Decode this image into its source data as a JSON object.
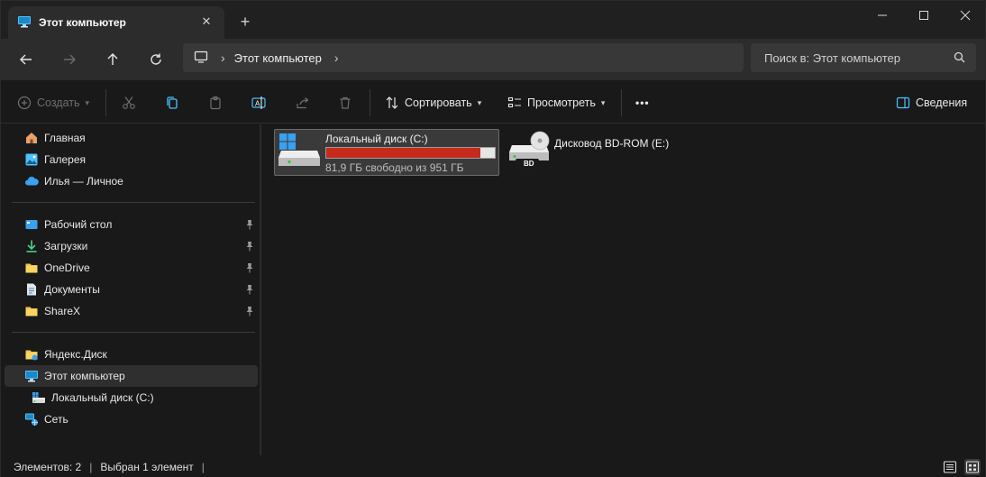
{
  "window": {
    "tab_title": "Этот компьютер",
    "new_tab_symbol": "+",
    "close_tab_symbol": "✕"
  },
  "nav": {
    "address_segment": "Этот компьютер",
    "search_placeholder": "Поиск в: Этот компьютер"
  },
  "toolbar": {
    "create_label": "Создать",
    "sort_label": "Сортировать",
    "view_label": "Просмотреть",
    "more_label": "•••",
    "details_label": "Сведения"
  },
  "sidebar": {
    "group1": [
      {
        "label": "Главная",
        "icon": "home-icon"
      },
      {
        "label": "Галерея",
        "icon": "gallery-icon"
      },
      {
        "label": "Илья — Личное",
        "icon": "onedrive-cloud-icon"
      }
    ],
    "group2": [
      {
        "label": "Рабочий стол",
        "icon": "desktop-folder-icon",
        "pinned": true
      },
      {
        "label": "Загрузки",
        "icon": "downloads-icon",
        "pinned": true
      },
      {
        "label": "OneDrive",
        "icon": "folder-icon",
        "pinned": true
      },
      {
        "label": "Документы",
        "icon": "documents-icon",
        "pinned": true
      },
      {
        "label": "ShareX",
        "icon": "folder-icon",
        "pinned": true
      }
    ],
    "group3": [
      {
        "label": "Яндекс.Диск",
        "icon": "yandex-disk-icon"
      },
      {
        "label": "Этот компьютер",
        "icon": "this-pc-icon",
        "selected": true
      },
      {
        "label": "Локальный диск (C:)",
        "icon": "drive-icon"
      },
      {
        "label": "Сеть",
        "icon": "network-icon"
      }
    ]
  },
  "drives": [
    {
      "name": "Локальный диск (C:)",
      "free_text": "81,9 ГБ свободно из 951 ГБ",
      "used_fraction": 0.914,
      "selected": true
    },
    {
      "name": "Дисковод BD-ROM (E:)",
      "disc_label": "BD"
    }
  ],
  "status": {
    "items_count": "Элементов: 2",
    "selected_text": "Выбран 1 элемент"
  },
  "colors": {
    "accent": "#4cc2ff",
    "usage_bar_full": "#c42b1c",
    "folder": "#f8c34a"
  }
}
